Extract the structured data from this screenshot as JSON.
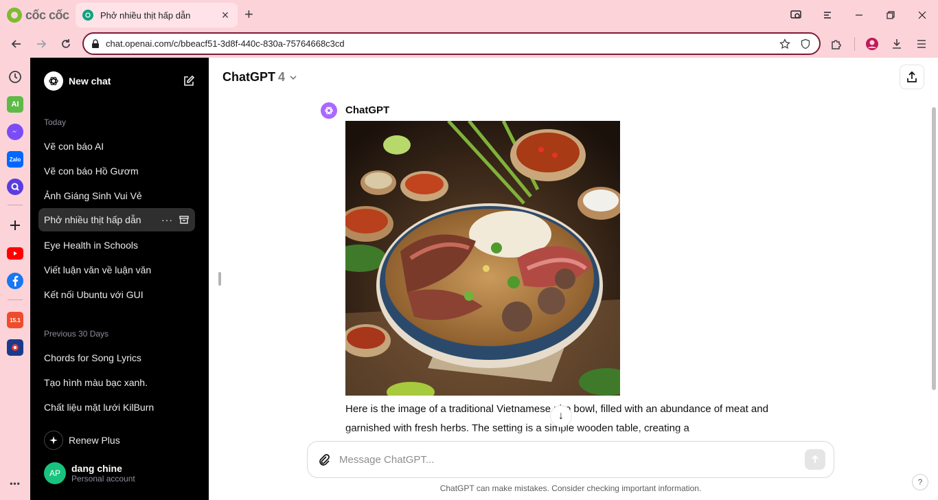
{
  "browser": {
    "brand": "cốc cốc",
    "tab": {
      "title": "Phở nhiều thịt hấp dẫn",
      "close": "×"
    },
    "new_tab": "+",
    "url": "chat.openai.com/c/bbeacf51-3d8f-440c-830a-75764668c3cd",
    "rail": [
      "history-icon",
      "ai-icon",
      "messenger-icon",
      "zalo-icon",
      "search-q-icon",
      "add-icon",
      "youtube-icon",
      "facebook-icon",
      "shopee-icon",
      "game-icon",
      "more-icon"
    ],
    "rail_ai_label": "AI",
    "rail_zalo_label": "Zalo",
    "rail_shopee_label": "15.1",
    "rail_more": "•••"
  },
  "sidebar": {
    "new_chat": "New chat",
    "today_label": "Today",
    "today": [
      {
        "label": "Vẽ con báo AI"
      },
      {
        "label": "Vẽ con báo Hồ Gươm"
      },
      {
        "label": "Ảnh Giáng Sinh Vui Vẻ"
      },
      {
        "label": "Phở nhiều thịt hấp dẫn"
      },
      {
        "label": "Eye Health in Schools"
      },
      {
        "label": "Viết luận văn về luận văn"
      },
      {
        "label": "Kết nối Ubuntu với GUI"
      }
    ],
    "prev_label": "Previous 30 Days",
    "previous": [
      {
        "label": "Chords for Song Lyrics"
      },
      {
        "label": "Tạo hình màu bạc xanh."
      },
      {
        "label": "Chất liệu mặt lưới KilBurn"
      }
    ],
    "more_options": "···",
    "renew": "Renew Plus",
    "user": {
      "initials": "AP",
      "name": "dang chine",
      "type": "Personal account"
    }
  },
  "main": {
    "model_name": "ChatGPT",
    "model_version": "4",
    "author": "ChatGPT",
    "message_text": "Here is the image of a traditional Vietnamese pho bowl, filled with an abundance of meat and garnished with fresh herbs. The setting is a simple wooden table, creating a",
    "scroll_down": "↓",
    "input_placeholder": "Message ChatGPT...",
    "disclaimer": "ChatGPT can make mistakes. Consider checking important information.",
    "help": "?"
  },
  "colors": {
    "accent": "#10a37f",
    "chrome": "#fbd3d9",
    "omnibox_border": "#7d1a33",
    "sidebar": "#000000"
  }
}
